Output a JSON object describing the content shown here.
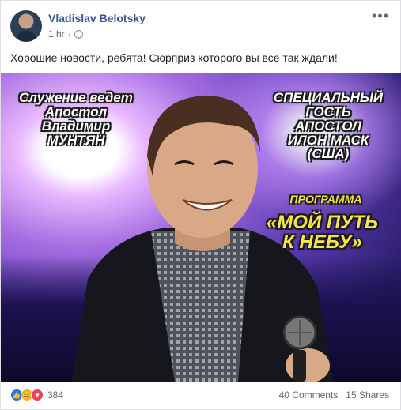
{
  "post": {
    "author": "Vladislav Belotsky",
    "time": "1 hr",
    "separator": "·",
    "text": "Хорошие новости, ребята! Сюрприз которого вы все так ждали!",
    "more_icon": "more-dots-icon"
  },
  "image": {
    "left_lines": [
      "Служение ведет",
      "Апостол",
      "Владимир",
      "МУНТЯН"
    ],
    "right_lines": [
      "СПЕЦИАЛЬНЫЙ",
      "ГОСТЬ",
      "АПОСТОЛ",
      "ИЛОН МАСК",
      "(США)"
    ],
    "program_label": "ПРОГРАММА",
    "program_title_1": "«МОЙ ПУТЬ",
    "program_title_2": "К НЕБУ»"
  },
  "footer": {
    "reactions_count": "384",
    "comments": "40 Comments",
    "shares": "15 Shares"
  },
  "colors": {
    "link": "#385898",
    "like": "#1877f2",
    "haha": "#f7b125",
    "love": "#f33e58"
  }
}
